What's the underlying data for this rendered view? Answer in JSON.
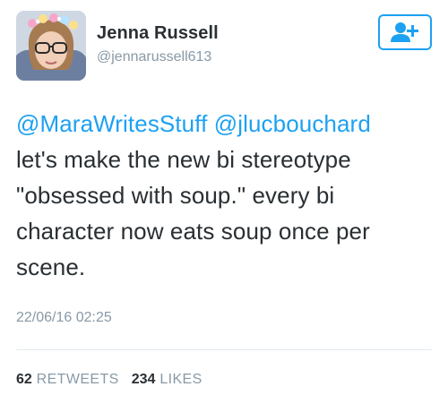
{
  "user": {
    "display_name": "Jenna Russell",
    "handle": "@jennarussell613"
  },
  "follow_button": {
    "icon": "add-user-icon"
  },
  "tweet": {
    "mentions": [
      "@MaraWritesStuff",
      "@jlucbouchard"
    ],
    "lines": [
      "let's make the new bi stereotype",
      "\"obsessed with soup.\" every bi",
      "character now eats soup once per",
      "scene."
    ],
    "timestamp": "22/06/16 02:25"
  },
  "stats": {
    "retweets_count": "62",
    "retweets_label": "RETWEETS",
    "likes_count": "234",
    "likes_label": "LIKES"
  },
  "colors": {
    "accent": "#1da1f2",
    "text": "#292f33",
    "muted": "#8899a6",
    "divider": "#e1e8ed"
  }
}
